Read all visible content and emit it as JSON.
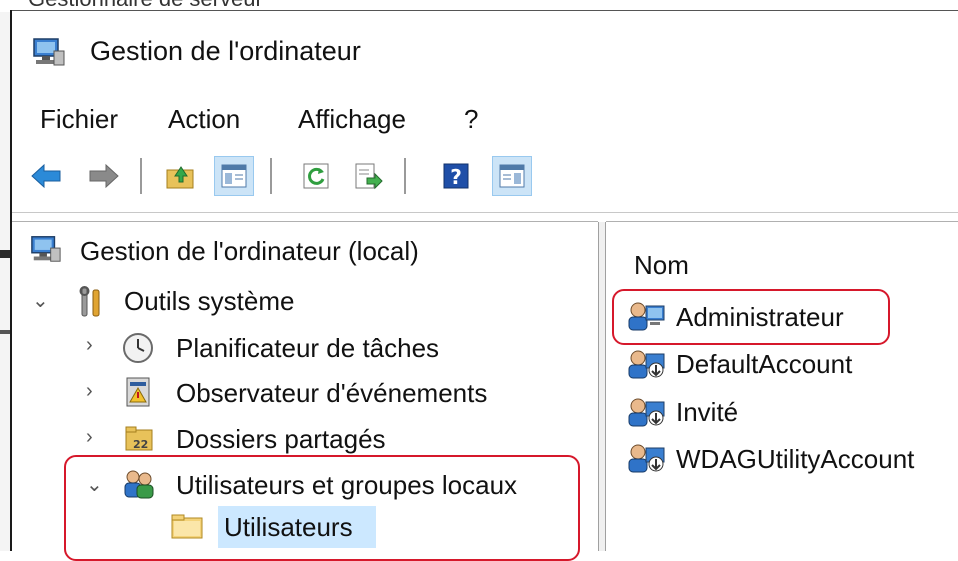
{
  "window": {
    "title": "Gestion de l'ordinateur",
    "cut_off_title": "Gestionnaire de serveur"
  },
  "menu": {
    "items": [
      "Fichier",
      "Action",
      "Affichage",
      "?"
    ]
  },
  "toolbar": {
    "buttons": [
      "back-arrow-icon",
      "forward-arrow-icon",
      "up-folder-icon",
      "show-hide-tree-icon",
      "refresh-icon",
      "export-list-icon",
      "help-icon",
      "show-hide-action-pane-icon"
    ]
  },
  "tree": {
    "root": "Gestion de l'ordinateur (local)",
    "system_tools": "Outils système",
    "task_scheduler": "Planificateur de tâches",
    "event_viewer": "Observateur d'événements",
    "shared_folders": "Dossiers partagés",
    "local_users_groups": "Utilisateurs et groupes locaux",
    "users": "Utilisateurs"
  },
  "list": {
    "column_header": "Nom",
    "rows": [
      "Administrateur",
      "DefaultAccount",
      "Invité",
      "WDAGUtilityAccount"
    ]
  },
  "colors": {
    "highlight_red": "#d6182b",
    "selection_blue": "#cce8ff",
    "toolbar_active": "#cce4f7"
  }
}
